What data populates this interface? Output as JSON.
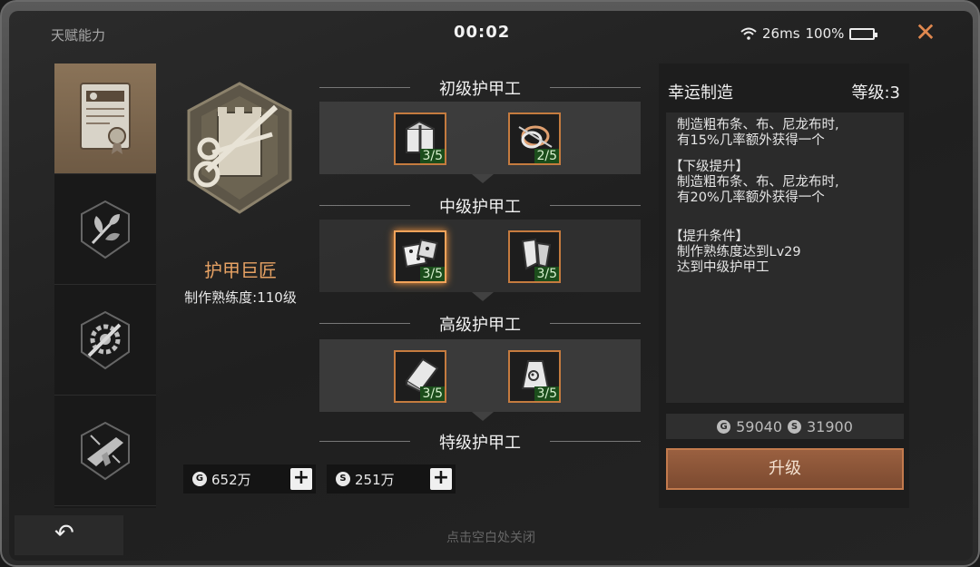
{
  "status": {
    "page_title": "天赋能力",
    "timer": "00:02",
    "ping": "26ms",
    "battery": "100%"
  },
  "nav": {
    "items": [
      {
        "name": "trade-certificate-icon",
        "active": true
      },
      {
        "name": "herb-icon",
        "active": false
      },
      {
        "name": "gear-wrench-icon",
        "active": false
      },
      {
        "name": "gun-icon",
        "active": false
      }
    ]
  },
  "skill": {
    "name": "护甲巨匠",
    "proficiency": "制作熟练度:110级"
  },
  "currency": {
    "gold": "652万",
    "silver": "251万"
  },
  "tiers": [
    {
      "title": "初级护甲工",
      "nodes": [
        {
          "icon": "gift-box-icon",
          "count": "3/5"
        },
        {
          "icon": "rope-icon",
          "count": "2/5"
        }
      ]
    },
    {
      "title": "中级护甲工",
      "nodes": [
        {
          "icon": "dice-icon",
          "count": "3/5"
        },
        {
          "icon": "armor-pieces-icon",
          "count": "3/5"
        }
      ]
    },
    {
      "title": "高级护甲工",
      "nodes": [
        {
          "icon": "fabric-icon",
          "count": "3/5"
        },
        {
          "icon": "sack-icon",
          "count": "3/5"
        }
      ]
    },
    {
      "title": "特级护甲工"
    }
  ],
  "detail": {
    "title": "幸运制造",
    "level": "等级:3",
    "current_line1": "制造粗布条、布、尼龙布时,",
    "current_line2": "有15%几率额外获得一个",
    "next_header": "【下级提升】",
    "next_line1": "制造粗布条、布、尼龙布时,",
    "next_line2": "有20%几率额外获得一个",
    "cond_header": "【提升条件】",
    "cond_line1": "制作熟练度达到Lv29",
    "cond_line2": "达到中级护甲工",
    "cost_gold": "59040",
    "cost_silver": "31900",
    "upgrade_label": "升级"
  },
  "footer": {
    "hint": "点击空白处关闭"
  },
  "colors": {
    "accent_orange": "#e0884f",
    "counter_green": "#1b4d1b"
  }
}
